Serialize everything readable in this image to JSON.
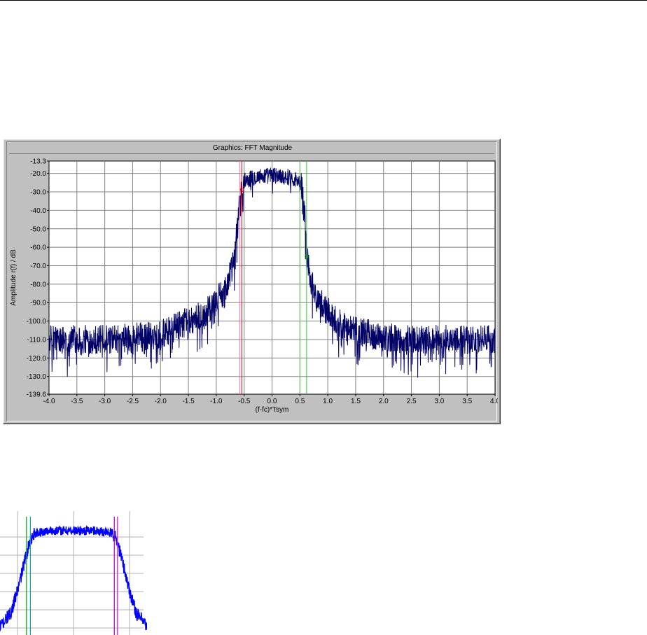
{
  "main_window": {
    "title": "Graphics: FFT Magnitude"
  },
  "chart_data": [
    {
      "type": "line",
      "title": "Graphics: FFT Magnitude",
      "xlabel": "(f-fc)*Tsym",
      "ylabel": "Amplitude r(f) / dB",
      "xlim": [
        -4.0,
        4.0
      ],
      "ylim": [
        -139.6,
        -13.3
      ],
      "x_ticks": [
        "-4.0",
        "-3.5",
        "-3.0",
        "-2.5",
        "-2.0",
        "-1.5",
        "-1.0",
        "-0.5",
        "0.0",
        "0.5",
        "1.0",
        "1.5",
        "2.0",
        "2.5",
        "3.0",
        "3.5",
        "4.0"
      ],
      "y_ticks": [
        "-13.3",
        "-20.0",
        "-30.0",
        "-40.0",
        "-50.0",
        "-60.0",
        "-70.0",
        "-80.0",
        "-90.0",
        "-100.0",
        "-110.0",
        "-120.0",
        "-130.0",
        "-139.6"
      ],
      "grid": true,
      "series": [
        {
          "color": "#000066",
          "x": [
            -4.0,
            -3.5,
            -3.0,
            -2.5,
            -2.0,
            -1.5,
            -1.2,
            -1.0,
            -0.8,
            -0.7,
            -0.62,
            -0.55,
            -0.5,
            -0.3,
            0.0,
            0.3,
            0.5,
            0.55,
            0.6,
            0.62,
            0.7,
            0.8,
            1.0,
            1.2,
            1.5,
            2.0,
            2.5,
            3.0,
            3.5,
            4.0
          ],
          "y": [
            -110,
            -110,
            -110,
            -109,
            -107,
            -100,
            -96,
            -90,
            -80,
            -70,
            -45,
            -30,
            -24,
            -22,
            -21,
            -22,
            -24,
            -30,
            -47,
            -65,
            -78,
            -87,
            -95,
            -101,
            -105,
            -109,
            -110,
            -110,
            -110,
            -110
          ]
        }
      ],
      "markers": [
        {
          "x": -0.54,
          "color": "#ff0000"
        },
        {
          "x": -0.58,
          "color": "#ff69b4"
        },
        {
          "x": 0.5,
          "color": "#66cc66"
        },
        {
          "x": 0.62,
          "color": "#33cc33"
        }
      ]
    },
    {
      "type": "line",
      "series": [
        {
          "color": "#0000ff",
          "x": [
            -1.0,
            -0.8,
            -0.7,
            -0.62,
            -0.55,
            -0.5,
            -0.3,
            0.0,
            0.3,
            0.5,
            0.55,
            0.62,
            0.7,
            0.8,
            1.0
          ],
          "y": [
            -95,
            -80,
            -60,
            -40,
            -25,
            -20,
            -18,
            -18,
            -18,
            -20,
            -25,
            -40,
            -60,
            -80,
            -95
          ]
        }
      ],
      "markers": [
        {
          "x": -0.6,
          "color": "#00aa00"
        },
        {
          "x": -0.55,
          "color": "#00aaaa"
        },
        {
          "x": 0.52,
          "color": "#aa00aa"
        },
        {
          "x": 0.56,
          "color": "#ff00ff"
        }
      ]
    }
  ]
}
